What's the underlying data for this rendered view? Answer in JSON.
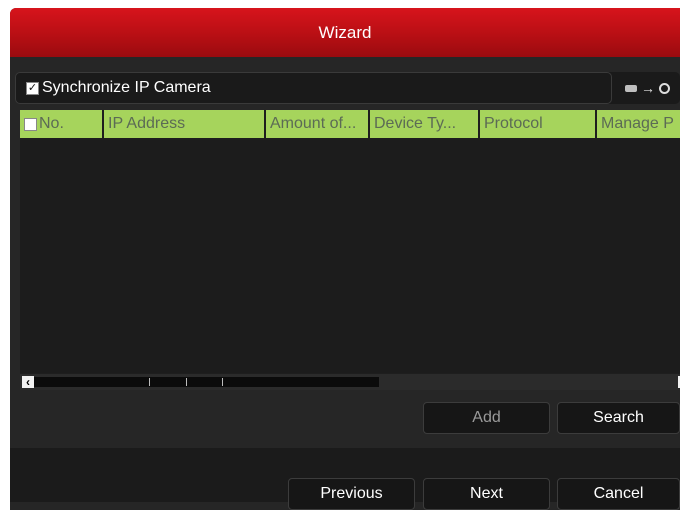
{
  "window": {
    "title": "Wizard"
  },
  "sync": {
    "checked": true,
    "label": "Synchronize IP Camera",
    "icons": [
      "hdd-icon",
      "arrow-right-icon",
      "clock-icon"
    ]
  },
  "table": {
    "columns": [
      "No.",
      "IP Address",
      "Amount of...",
      "Device Ty...",
      "Protocol",
      "Manage P"
    ],
    "rows": []
  },
  "buttons": {
    "add": "Add",
    "search": "Search",
    "previous": "Previous",
    "next": "Next",
    "cancel": "Cancel"
  },
  "colors": {
    "title_bar": "#c8121a",
    "header_bg": "#a6d45c",
    "panel_bg": "#262626"
  }
}
